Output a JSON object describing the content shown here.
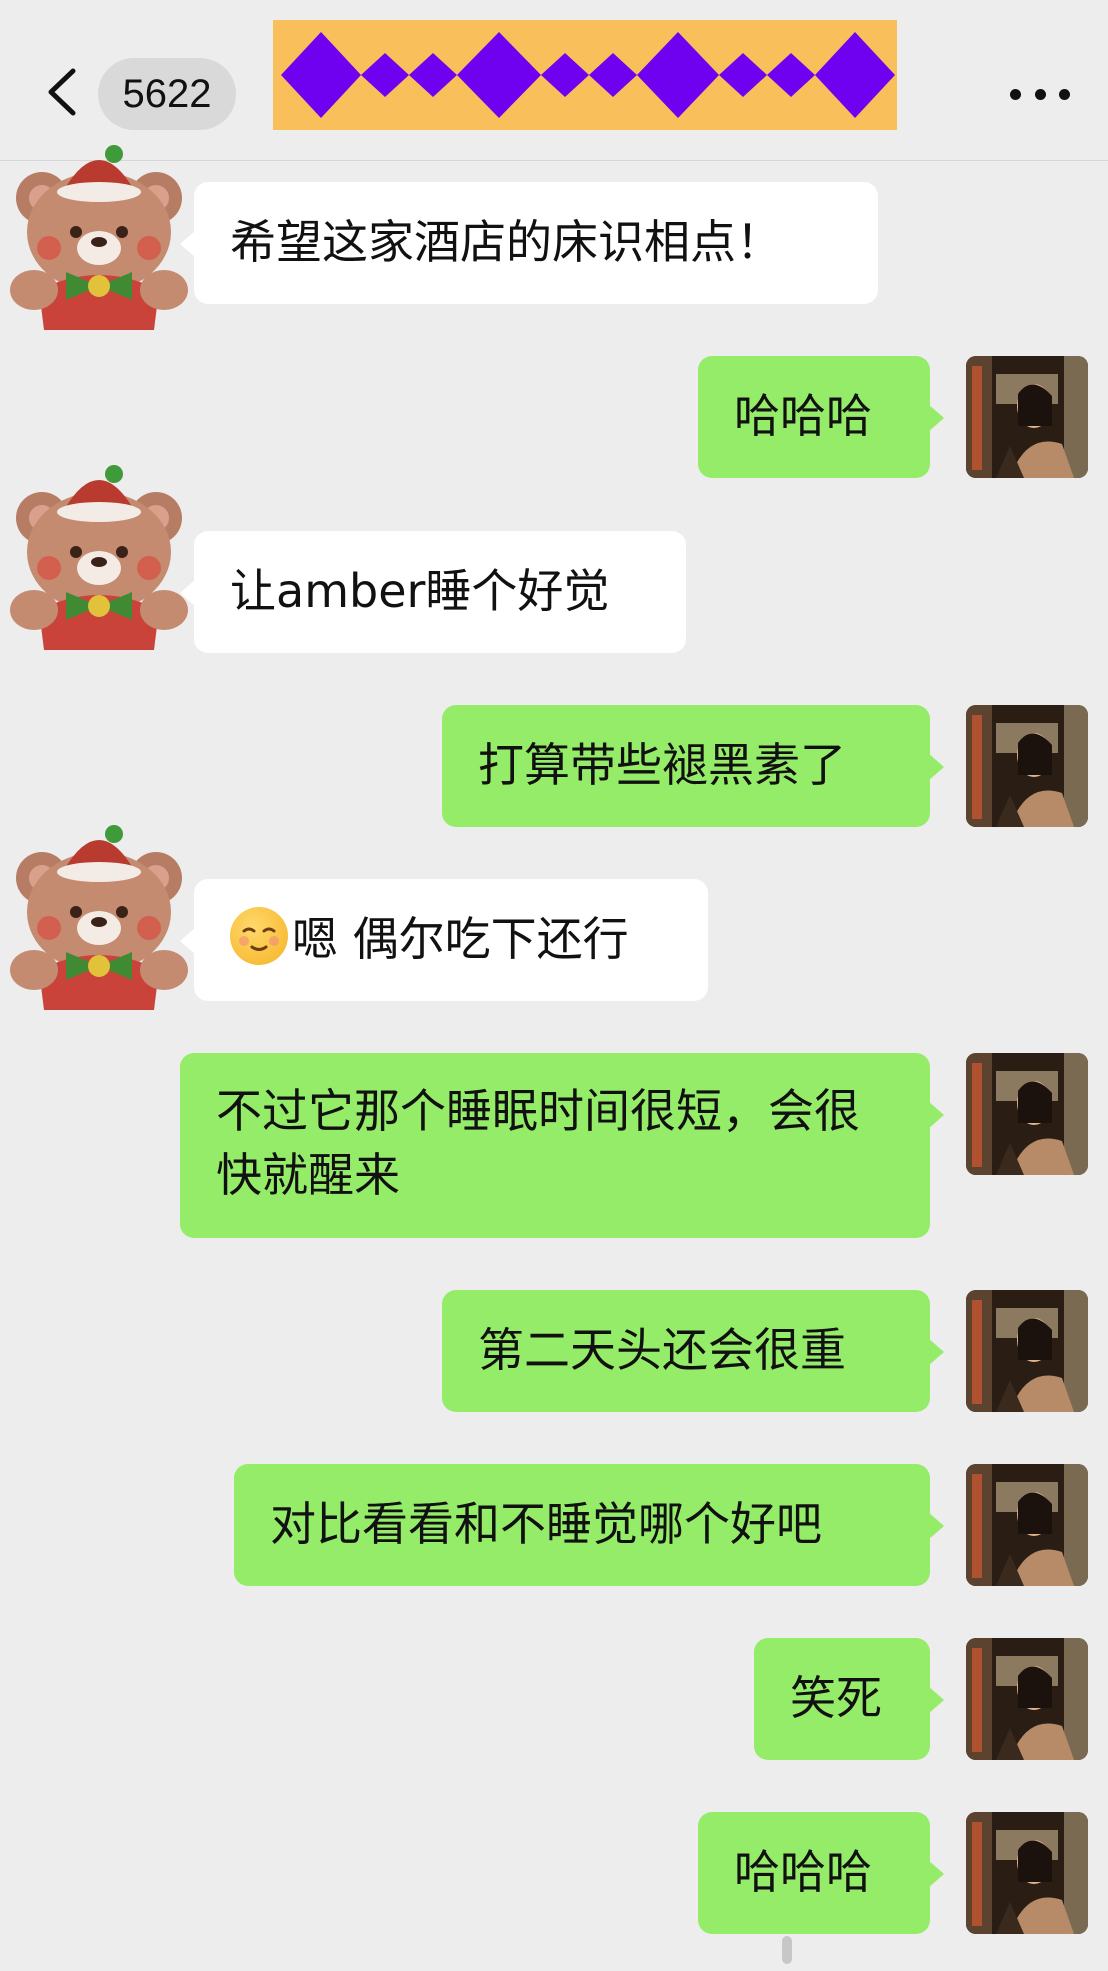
{
  "header": {
    "unread_count": "5622",
    "back_icon": "chevron-left-icon",
    "more_icon": "ellipsis-icon"
  },
  "messages": [
    {
      "side": "left",
      "text": "希望这家酒店的床识相点！"
    },
    {
      "side": "right",
      "text": "哈哈哈"
    },
    {
      "side": "left",
      "text": "让amber睡个好觉"
    },
    {
      "side": "right",
      "text": "打算带些褪黑素了"
    },
    {
      "side": "left",
      "text": "嗯 偶尔吃下还行",
      "emoji": "relieved-face-emoji"
    },
    {
      "side": "right",
      "text": "不过它那个睡眠时间很短，会很快就醒来"
    },
    {
      "side": "right",
      "text": "第二天头还会很重"
    },
    {
      "side": "right",
      "text": "对比看看和不睡觉哪个好吧"
    },
    {
      "side": "right",
      "text": "笑死"
    },
    {
      "side": "right",
      "text": "哈哈哈"
    }
  ],
  "colors": {
    "background": "#ededed",
    "sent_bubble": "#95ec69",
    "received_bubble": "#ffffff",
    "title_redaction": "#f8bf5a",
    "redaction_diamonds": "#7000f0"
  }
}
